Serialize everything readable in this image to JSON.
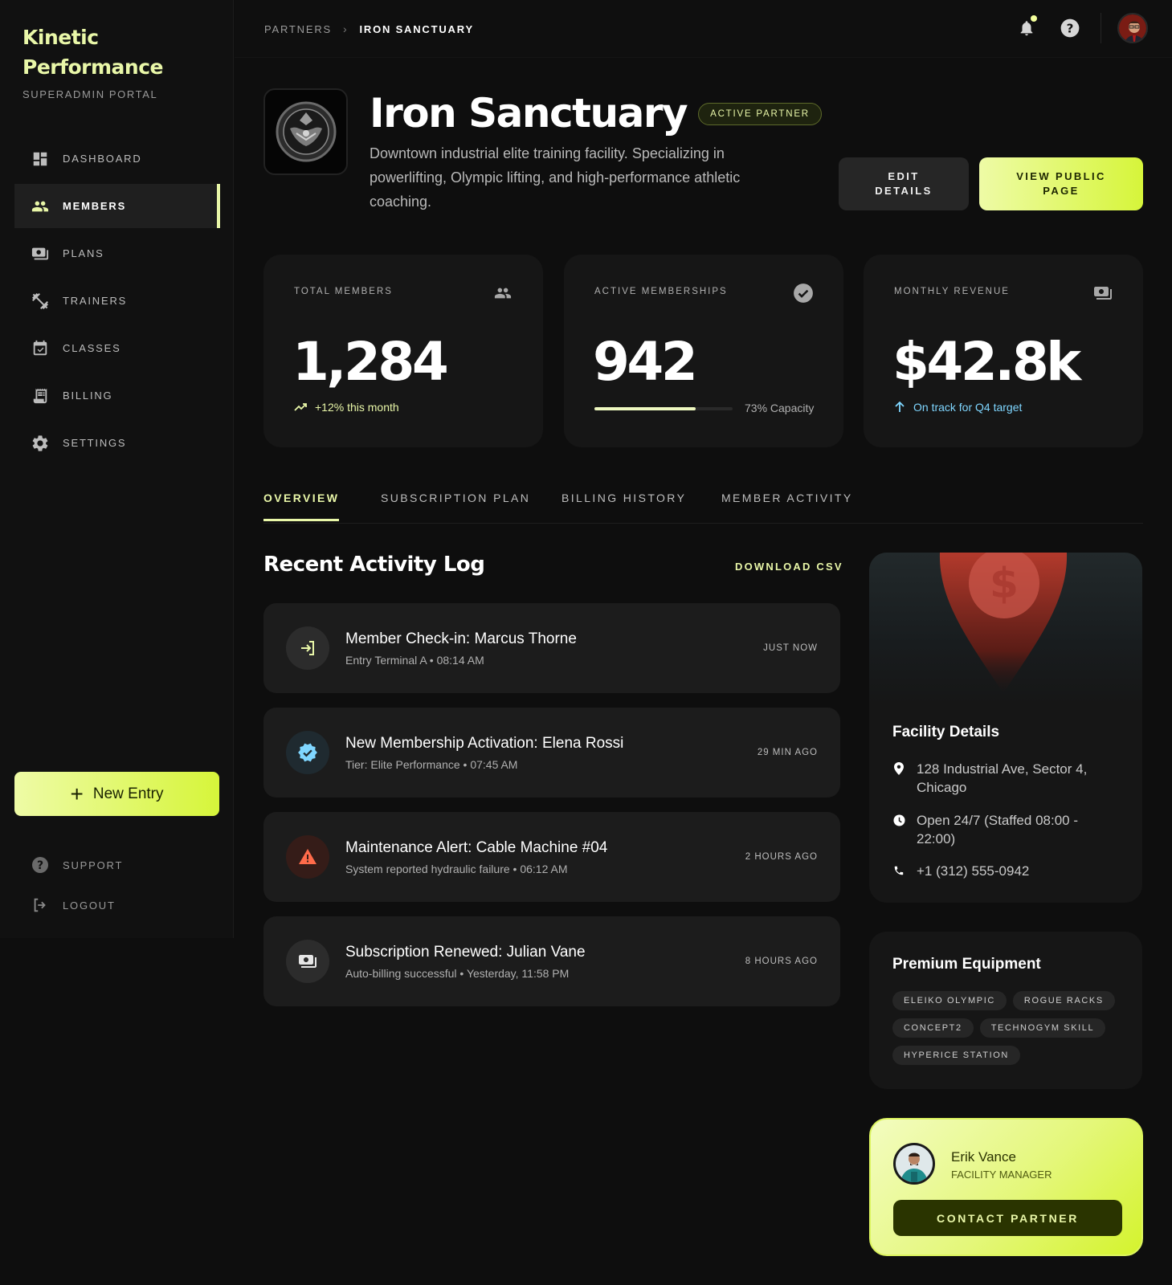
{
  "brand": {
    "name": "Kinetic Performance",
    "subtitle": "SUPERADMIN PORTAL"
  },
  "sidebar": {
    "items": [
      {
        "label": "DASHBOARD",
        "icon": "dashboard-icon"
      },
      {
        "label": "MEMBERS",
        "icon": "members-icon",
        "active": true
      },
      {
        "label": "PLANS",
        "icon": "plans-icon"
      },
      {
        "label": "TRAINERS",
        "icon": "trainers-icon"
      },
      {
        "label": "CLASSES",
        "icon": "classes-icon"
      },
      {
        "label": "BILLING",
        "icon": "billing-icon"
      },
      {
        "label": "SETTINGS",
        "icon": "settings-icon"
      }
    ],
    "new_entry_label": "New Entry",
    "footer": [
      {
        "label": "SUPPORT",
        "icon": "support-icon"
      },
      {
        "label": "LOGOUT",
        "icon": "logout-icon"
      }
    ]
  },
  "topbar": {
    "breadcrumb": [
      "PARTNERS",
      "IRON SANCTUARY"
    ],
    "icons": [
      "bell-icon",
      "help-icon",
      "user-avatar"
    ]
  },
  "header": {
    "title": "Iron Sanctuary",
    "badge": "ACTIVE PARTNER",
    "description": "Downtown industrial elite training facility. Specializing in powerlifting, Olympic lifting, and high-performance athletic coaching.",
    "edit_label": "EDIT DETAILS",
    "view_label": "VIEW PUBLIC PAGE"
  },
  "stats": [
    {
      "label": "TOTAL MEMBERS",
      "value": "1,284",
      "note": "+12% this month",
      "icon": "group-icon"
    },
    {
      "label": "ACTIVE MEMBERSHIPS",
      "value": "942",
      "note": "73% Capacity",
      "capacity": 0.73,
      "icon": "check-circle-icon"
    },
    {
      "label": "MONTHLY REVENUE",
      "value": "$42.8k",
      "note": "On track for Q4 target",
      "icon": "money-icon"
    }
  ],
  "tabs": [
    "OVERVIEW",
    "SUBSCRIPTION PLAN",
    "BILLING HISTORY",
    "MEMBER ACTIVITY"
  ],
  "activity": {
    "title": "Recent Activity Log",
    "download_label": "DOWNLOAD CSV",
    "items": [
      {
        "title": "Member Check-in: Marcus Thorne",
        "sub": "Entry Terminal A • 08:14 AM",
        "time": "JUST NOW",
        "icon": "login-icon"
      },
      {
        "title": "New Membership Activation: Elena Rossi",
        "sub": "Tier: Elite Performance • 07:45 AM",
        "time": "29 MIN AGO",
        "icon": "verified-icon"
      },
      {
        "title": "Maintenance Alert: Cable Machine #04",
        "sub": "System reported hydraulic failure • 06:12 AM",
        "time": "2 HOURS AGO",
        "icon": "warning-icon"
      },
      {
        "title": "Subscription Renewed: Julian Vane",
        "sub": "Auto-billing successful • Yesterday, 11:58 PM",
        "time": "8 HOURS AGO",
        "icon": "payments-icon"
      }
    ]
  },
  "facility": {
    "title": "Facility Details",
    "address": "128 Industrial Ave, Sector 4, Chicago",
    "hours": "Open 24/7 (Staffed 08:00 - 22:00)",
    "phone": "+1 (312) 555-0942"
  },
  "equipment": {
    "title": "Premium Equipment",
    "tags": [
      "ELEIKO OLYMPIC",
      "ROGUE RACKS",
      "CONCEPT2",
      "TECHNOGYM SKILL",
      "HYPERICE STATION"
    ]
  },
  "manager": {
    "name": "Erik Vance",
    "role": "FACILITY MANAGER",
    "contact_label": "CONTACT PARTNER"
  },
  "colors": {
    "accent": "#e9f7a8",
    "accent_strong": "#d6f53a",
    "background": "#0e0e0e",
    "card": "#161616",
    "alert": "#ff6b4a",
    "info": "#7fd6ff"
  }
}
